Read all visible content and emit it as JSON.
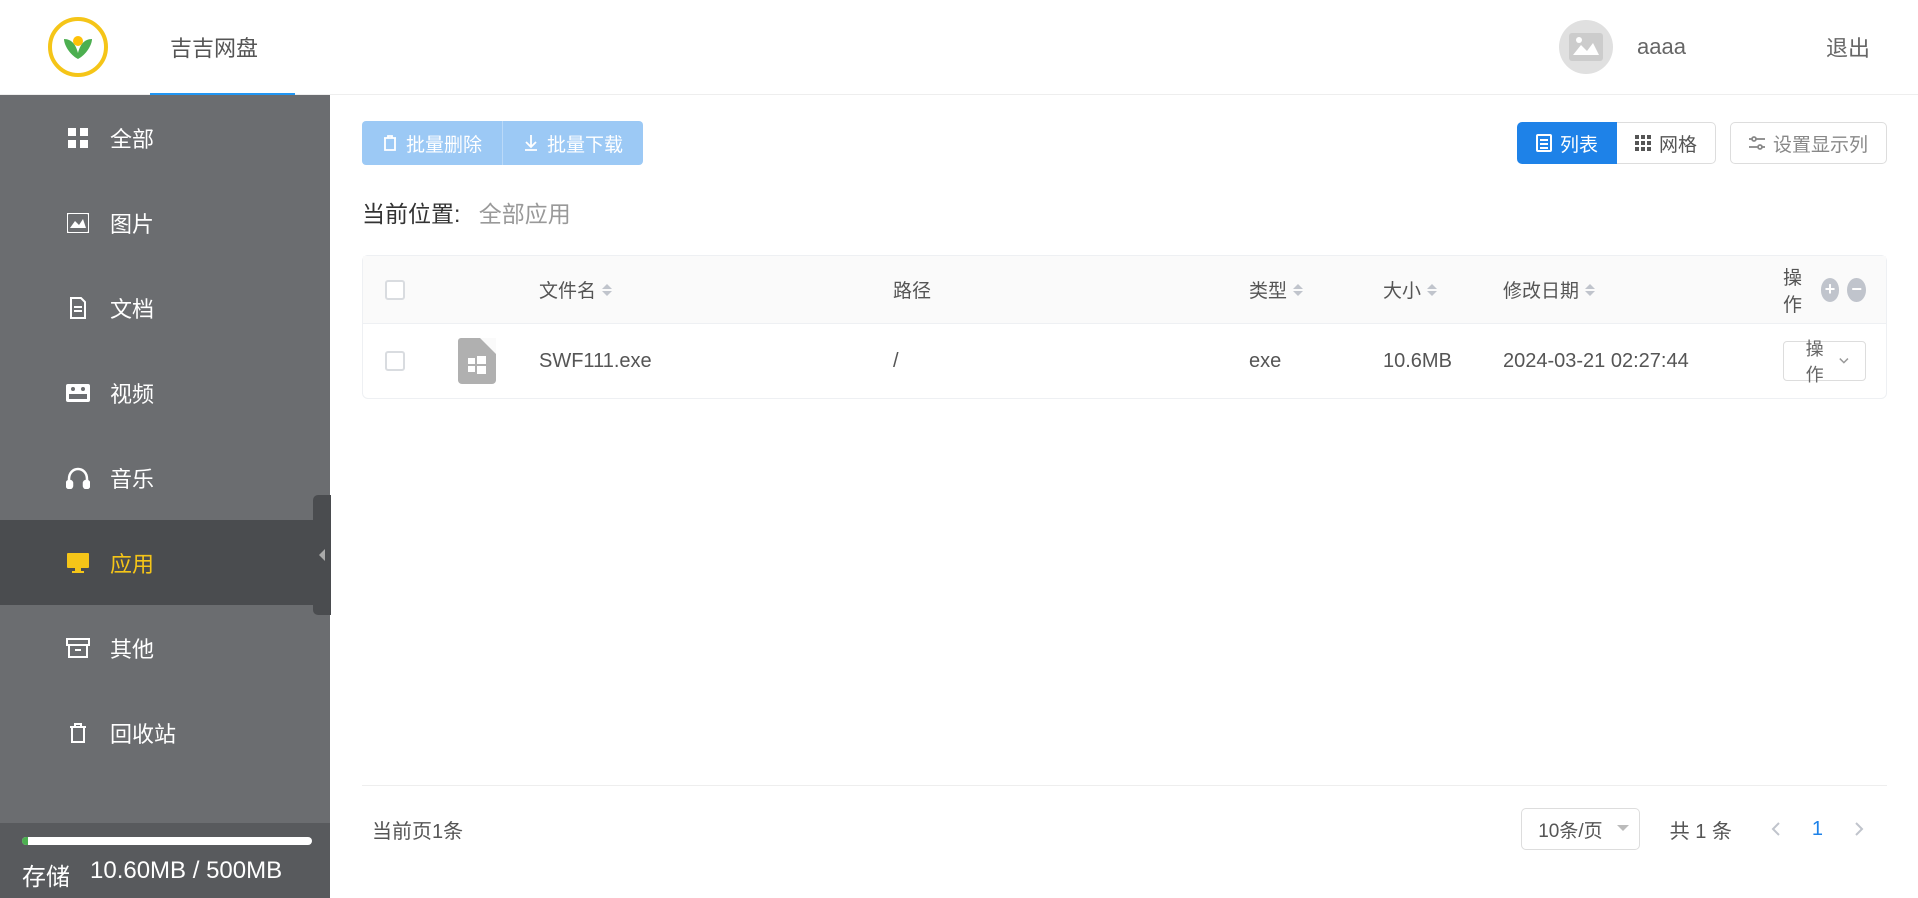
{
  "header": {
    "brand": "吉吉网盘",
    "username": "aaaa",
    "logout": "退出"
  },
  "sidebar": {
    "items": [
      {
        "label": "全部"
      },
      {
        "label": "图片"
      },
      {
        "label": "文档"
      },
      {
        "label": "视频"
      },
      {
        "label": "音乐"
      },
      {
        "label": "应用"
      },
      {
        "label": "其他"
      },
      {
        "label": "回收站"
      }
    ],
    "storage": {
      "label": "存储",
      "used": "10.60MB",
      "sep": "/",
      "total": "500MB"
    }
  },
  "toolbar": {
    "batchDelete": "批量删除",
    "batchDownload": "批量下载",
    "listView": "列表",
    "gridView": "网格",
    "setColumns": "设置显示列"
  },
  "breadcrumb": {
    "label": "当前位置:",
    "value": "全部应用"
  },
  "table": {
    "headers": {
      "name": "文件名",
      "path": "路径",
      "type": "类型",
      "size": "大小",
      "date": "修改日期",
      "op": "操作"
    },
    "rows": [
      {
        "name": "SWF111.exe",
        "path": "/",
        "type": "exe",
        "size": "10.6MB",
        "date": "2024-03-21 02:27:44",
        "opLabel": "操作"
      }
    ]
  },
  "footer": {
    "currentPage": "当前页1条",
    "pageSize": "10条/页",
    "totalPrefix": "共",
    "totalCount": "1",
    "totalSuffix": "条",
    "pageNum": "1"
  }
}
